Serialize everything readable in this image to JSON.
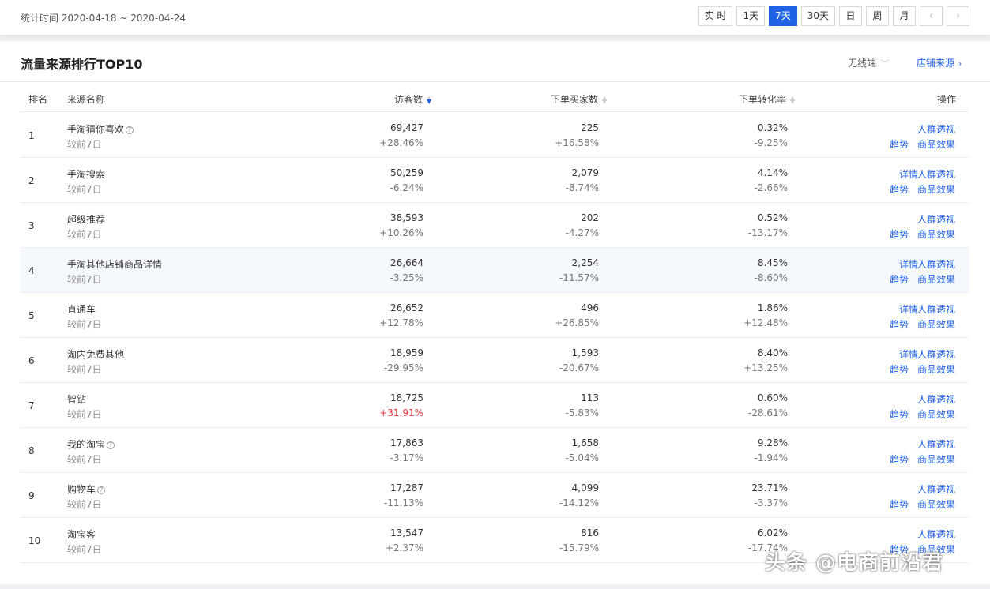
{
  "header": {
    "period_label": "统计时间 2020-04-18 ~ 2020-04-24",
    "buttons": [
      {
        "label": "实 时",
        "active": false
      },
      {
        "label": "1天",
        "active": false
      },
      {
        "label": "7天",
        "active": true
      },
      {
        "label": "30天",
        "active": false
      },
      {
        "label": "日",
        "active": false
      },
      {
        "label": "周",
        "active": false
      },
      {
        "label": "月",
        "active": false
      }
    ],
    "prev_icon": "‹",
    "next_icon": "›"
  },
  "panel": {
    "title": "流量来源排行TOP10",
    "device_select": "无线端",
    "device_chevron": "﹀",
    "store_link": "店铺来源",
    "store_chevron": "›"
  },
  "table": {
    "columns": {
      "rank": "排名",
      "source": "来源名称",
      "visitors": "访客数",
      "buyers": "下单买家数",
      "conversion": "下单转化率",
      "actions": "操作"
    },
    "compare_label": "较前7日",
    "help_icon": "?",
    "sort_up": "▲",
    "sort_down": "▼",
    "action_labels": {
      "detail": "详情",
      "crowd": "人群透视",
      "trend": "趋势",
      "product": "商品效果"
    },
    "rows": [
      {
        "rank": "1",
        "name": "手淘猜你喜欢",
        "help": true,
        "visitors": "69,427",
        "visitors_chg": "+28.46%",
        "visitors_red": false,
        "buyers": "225",
        "buyers_chg": "+16.58%",
        "conv": "0.32%",
        "conv_chg": "-9.25%",
        "has_detail": false
      },
      {
        "rank": "2",
        "name": "手淘搜索",
        "help": false,
        "visitors": "50,259",
        "visitors_chg": "-6.24%",
        "visitors_red": false,
        "buyers": "2,079",
        "buyers_chg": "-8.74%",
        "conv": "4.14%",
        "conv_chg": "-2.66%",
        "has_detail": true
      },
      {
        "rank": "3",
        "name": "超级推荐",
        "help": false,
        "visitors": "38,593",
        "visitors_chg": "+10.26%",
        "visitors_red": false,
        "buyers": "202",
        "buyers_chg": "-4.27%",
        "conv": "0.52%",
        "conv_chg": "-13.17%",
        "has_detail": false
      },
      {
        "rank": "4",
        "name": "手淘其他店铺商品详情",
        "help": false,
        "visitors": "26,664",
        "visitors_chg": "-3.25%",
        "visitors_red": false,
        "buyers": "2,254",
        "buyers_chg": "-11.57%",
        "conv": "8.45%",
        "conv_chg": "-8.60%",
        "has_detail": true
      },
      {
        "rank": "5",
        "name": "直通车",
        "help": false,
        "visitors": "26,652",
        "visitors_chg": "+12.78%",
        "visitors_red": false,
        "buyers": "496",
        "buyers_chg": "+26.85%",
        "conv": "1.86%",
        "conv_chg": "+12.48%",
        "has_detail": true
      },
      {
        "rank": "6",
        "name": "淘内免费其他",
        "help": false,
        "visitors": "18,959",
        "visitors_chg": "-29.95%",
        "visitors_red": false,
        "buyers": "1,593",
        "buyers_chg": "-20.67%",
        "conv": "8.40%",
        "conv_chg": "+13.25%",
        "has_detail": true
      },
      {
        "rank": "7",
        "name": "智钻",
        "help": false,
        "visitors": "18,725",
        "visitors_chg": "+31.91%",
        "visitors_red": true,
        "buyers": "113",
        "buyers_chg": "-5.83%",
        "conv": "0.60%",
        "conv_chg": "-28.61%",
        "has_detail": false
      },
      {
        "rank": "8",
        "name": "我的淘宝",
        "help": true,
        "visitors": "17,863",
        "visitors_chg": "-3.17%",
        "visitors_red": false,
        "buyers": "1,658",
        "buyers_chg": "-5.04%",
        "conv": "9.28%",
        "conv_chg": "-1.94%",
        "has_detail": false
      },
      {
        "rank": "9",
        "name": "购物车",
        "help": true,
        "visitors": "17,287",
        "visitors_chg": "-11.13%",
        "visitors_red": false,
        "buyers": "4,099",
        "buyers_chg": "-14.12%",
        "conv": "23.71%",
        "conv_chg": "-3.37%",
        "has_detail": false
      },
      {
        "rank": "10",
        "name": "淘宝客",
        "help": false,
        "visitors": "13,547",
        "visitors_chg": "+2.37%",
        "visitors_red": false,
        "buyers": "816",
        "buyers_chg": "-15.79%",
        "conv": "6.02%",
        "conv_chg": "-17.74%",
        "has_detail": false
      }
    ]
  },
  "watermark": "头条 @电商前沿君"
}
